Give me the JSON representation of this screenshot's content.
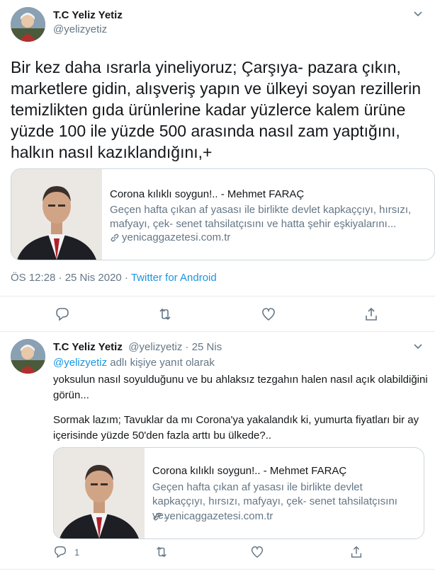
{
  "tweet": {
    "display_name": "T.C Yeliz Yetiz",
    "handle": "@yelizyetiz",
    "text": "Bir kez daha ısrarla yineliyoruz; Çarşıya- pazara çıkın, marketlere gidin, alışveriş yapın ve ülkeyi soyan rezillerin temizlikten gıda ürünlerine kadar yüzlerce kalem ürüne yüzde 100 ile yüzde 500 arasında nasıl zam yaptığını, halkın nasıl kazıklandığını,+",
    "card": {
      "title": "Corona kılıklı soygun!.. - Mehmet FARAÇ",
      "description": "Geçen hafta çıkan af yasası ile birlikte devlet kapkaççıyı, hırsızı, mafyayı, çek- senet tahsilatçısını ve hatta şehir eşkiyalarını...",
      "domain": "yenicaggazetesi.com.tr"
    },
    "time": "ÖS 12:28 · 25 Nis 2020 · ",
    "source": "Twitter for Android"
  },
  "reply": {
    "display_name": "T.C Yeliz Yetiz",
    "handle_date": "@yelizyetiz · 25 Nis",
    "replying_to_handle": "@yelizyetiz",
    "replying_to_suffix": " adlı kişiye yanıt olarak",
    "text_p1": "yoksulun nasıl soyulduğunu ve bu ahlaksız tezgahın halen nasıl açık olabildiğini görün...",
    "text_p2": "Sormak lazım; Tavuklar da mı Corona'ya yakalandık ki, yumurta fiyatları bir ay içerisinde yüzde 50'den fazla arttı bu ülkede?..",
    "card": {
      "title": "Corona kılıklı soygun!.. - Mehmet FARAÇ",
      "description": "Geçen hafta çıkan af yasası ile birlikte devlet kapkaççıyı, hırsızı, mafyayı, çek- senet tahsilatçısını ve...",
      "domain": "yenicaggazetesi.com.tr"
    },
    "reply_count": "1"
  },
  "icons": [
    "chevron-down-icon",
    "reply-icon",
    "retweet-icon",
    "like-icon",
    "share-icon",
    "link-icon"
  ],
  "colors": {
    "accent": "#1b95e0",
    "muted": "#657786",
    "border": "#ccd6dd"
  }
}
